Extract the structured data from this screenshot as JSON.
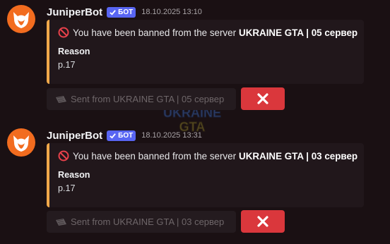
{
  "messages": [
    {
      "author": "JuniperBot",
      "badge": "БОТ",
      "timestamp": "18.10.2025 13:10",
      "embed": {
        "accent_color": "#f0a84a",
        "icon": "no-entry-icon",
        "description_prefix": "You have been banned from the server",
        "server_name": "UKRAINE GTA | 05 сервер",
        "field_name": "Reason",
        "field_value": "p.17"
      },
      "footer_button": "Sent from UKRAINE GTA | 05 сервер",
      "close_button_icon": "x-icon"
    },
    {
      "author": "JuniperBot",
      "badge": "БОТ",
      "timestamp": "18.10.2025 13:31",
      "embed": {
        "accent_color": "#f0a84a",
        "icon": "no-entry-icon",
        "description_prefix": "You have been banned from the server",
        "server_name": "UKRAINE GTA | 03 сервер",
        "field_name": "Reason",
        "field_value": "p.17"
      },
      "footer_button": "Sent from UKRAINE GTA | 03 сервер",
      "close_button_icon": "x-icon"
    }
  ],
  "colors": {
    "background": "#1a1013",
    "bot_badge": "#5865f2",
    "danger_button": "#da373c",
    "avatar": "#f26c1f"
  }
}
